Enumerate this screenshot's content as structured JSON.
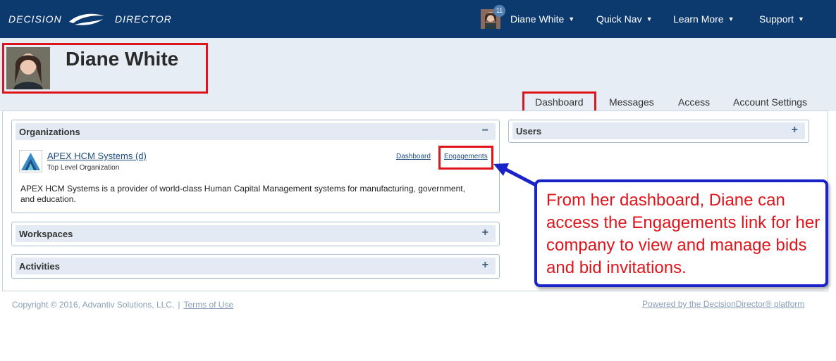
{
  "header": {
    "logo_left": "DECISION",
    "logo_right": "DIRECTOR",
    "notification_count": "11",
    "nav": [
      {
        "label": "Diane White"
      },
      {
        "label": "Quick Nav"
      },
      {
        "label": "Learn More"
      },
      {
        "label": "Support"
      }
    ]
  },
  "profile": {
    "name": "Diane White"
  },
  "tabs": [
    {
      "label": "Dashboard",
      "active": true
    },
    {
      "label": "Messages"
    },
    {
      "label": "Access"
    },
    {
      "label": "Account Settings"
    }
  ],
  "panels": {
    "organizations": {
      "title": "Organizations",
      "collapse_icon": "minus-icon",
      "org": {
        "name": "APEX HCM Systems (d)",
        "subtitle": "Top Level Organization",
        "dashboard_link": "Dashboard",
        "engagements_link": "Engagements",
        "description": "APEX HCM Systems is a provider of world-class Human Capital Management systems for manufacturing, government, and education."
      }
    },
    "workspaces": {
      "title": "Workspaces",
      "expand_icon": "plus-icon"
    },
    "activities": {
      "title": "Activities",
      "expand_icon": "plus-icon"
    },
    "users": {
      "title": "Users",
      "expand_icon": "plus-icon"
    }
  },
  "callout": {
    "text": "From her dashboard, Diane can access the Engagements link for her company to view and manage bids and bid invitations."
  },
  "footer": {
    "copyright": "Copyright © 2016, Advantiv Solutions, LLC.",
    "separator": "|",
    "terms": "Terms of Use",
    "powered": "Powered by the DecisionDirector® platform"
  },
  "colors": {
    "header_bg": "#0d3a6e",
    "highlight_red": "#e0151b",
    "callout_blue": "#1a22c9",
    "panel_head": "#e3eaf3"
  }
}
